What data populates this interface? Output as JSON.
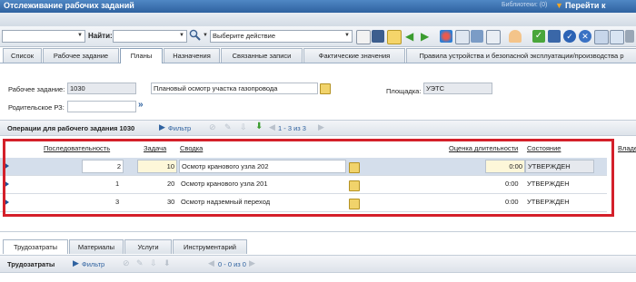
{
  "titlebar": {
    "title": "Отслеживание рабочих заданий",
    "bookmarks": "Библиотеки: (0)",
    "goto": "Перейти к"
  },
  "toolbar": {
    "find_label": "Найти:",
    "action_placeholder": "Выберите действие"
  },
  "tabs": [
    {
      "label": "Список"
    },
    {
      "label": "Рабочее задание"
    },
    {
      "label": "Планы"
    },
    {
      "label": "Назначения"
    },
    {
      "label": "Связанные записи"
    },
    {
      "label": "Фактические значения"
    },
    {
      "label": "Правила устройства и безопасной эксплуатации/производства р"
    }
  ],
  "form": {
    "wo_label": "Рабочее задание:",
    "wo_value": "1030",
    "wo_desc": "Плановый осмотр участка газопровода",
    "site_label": "Площадка:",
    "site_value": "УЭТС",
    "parent_label": "Родительское РЗ:"
  },
  "ops": {
    "title": "Операции для рабочего задания 1030",
    "filter": "Фильтр",
    "pager": "1 - 3 из 3"
  },
  "grid": {
    "headers": {
      "seq": "Последовательность",
      "task": "Задача",
      "summary": "Сводка",
      "duration": "Оценка длительности",
      "status": "Состояние",
      "owner": "Владе"
    },
    "rows": [
      {
        "seq": "2",
        "task": "10",
        "summary": "Осмотр кранового узла 202",
        "duration": "0:00",
        "status": "УТВЕРЖДЕН"
      },
      {
        "seq": "1",
        "task": "20",
        "summary": "Осмотр кранового узла 201",
        "duration": "0:00",
        "status": "УТВЕРЖДЕН"
      },
      {
        "seq": "3",
        "task": "30",
        "summary": "Осмотр надземный переход",
        "duration": "0:00",
        "status": "УТВЕРЖДЕН"
      }
    ]
  },
  "bottom_tabs": [
    {
      "label": "Трудозатраты"
    },
    {
      "label": "Материалы"
    },
    {
      "label": "Услуги"
    },
    {
      "label": "Инструментарий"
    }
  ],
  "bottom_bar": {
    "title": "Трудозатраты",
    "filter": "Фильтр",
    "pager": "0 - 0 из 0"
  },
  "colors": {
    "titlebar": "#2f62a0",
    "highlight_frame": "#d4202a",
    "selected_row": "#d4deeb"
  }
}
